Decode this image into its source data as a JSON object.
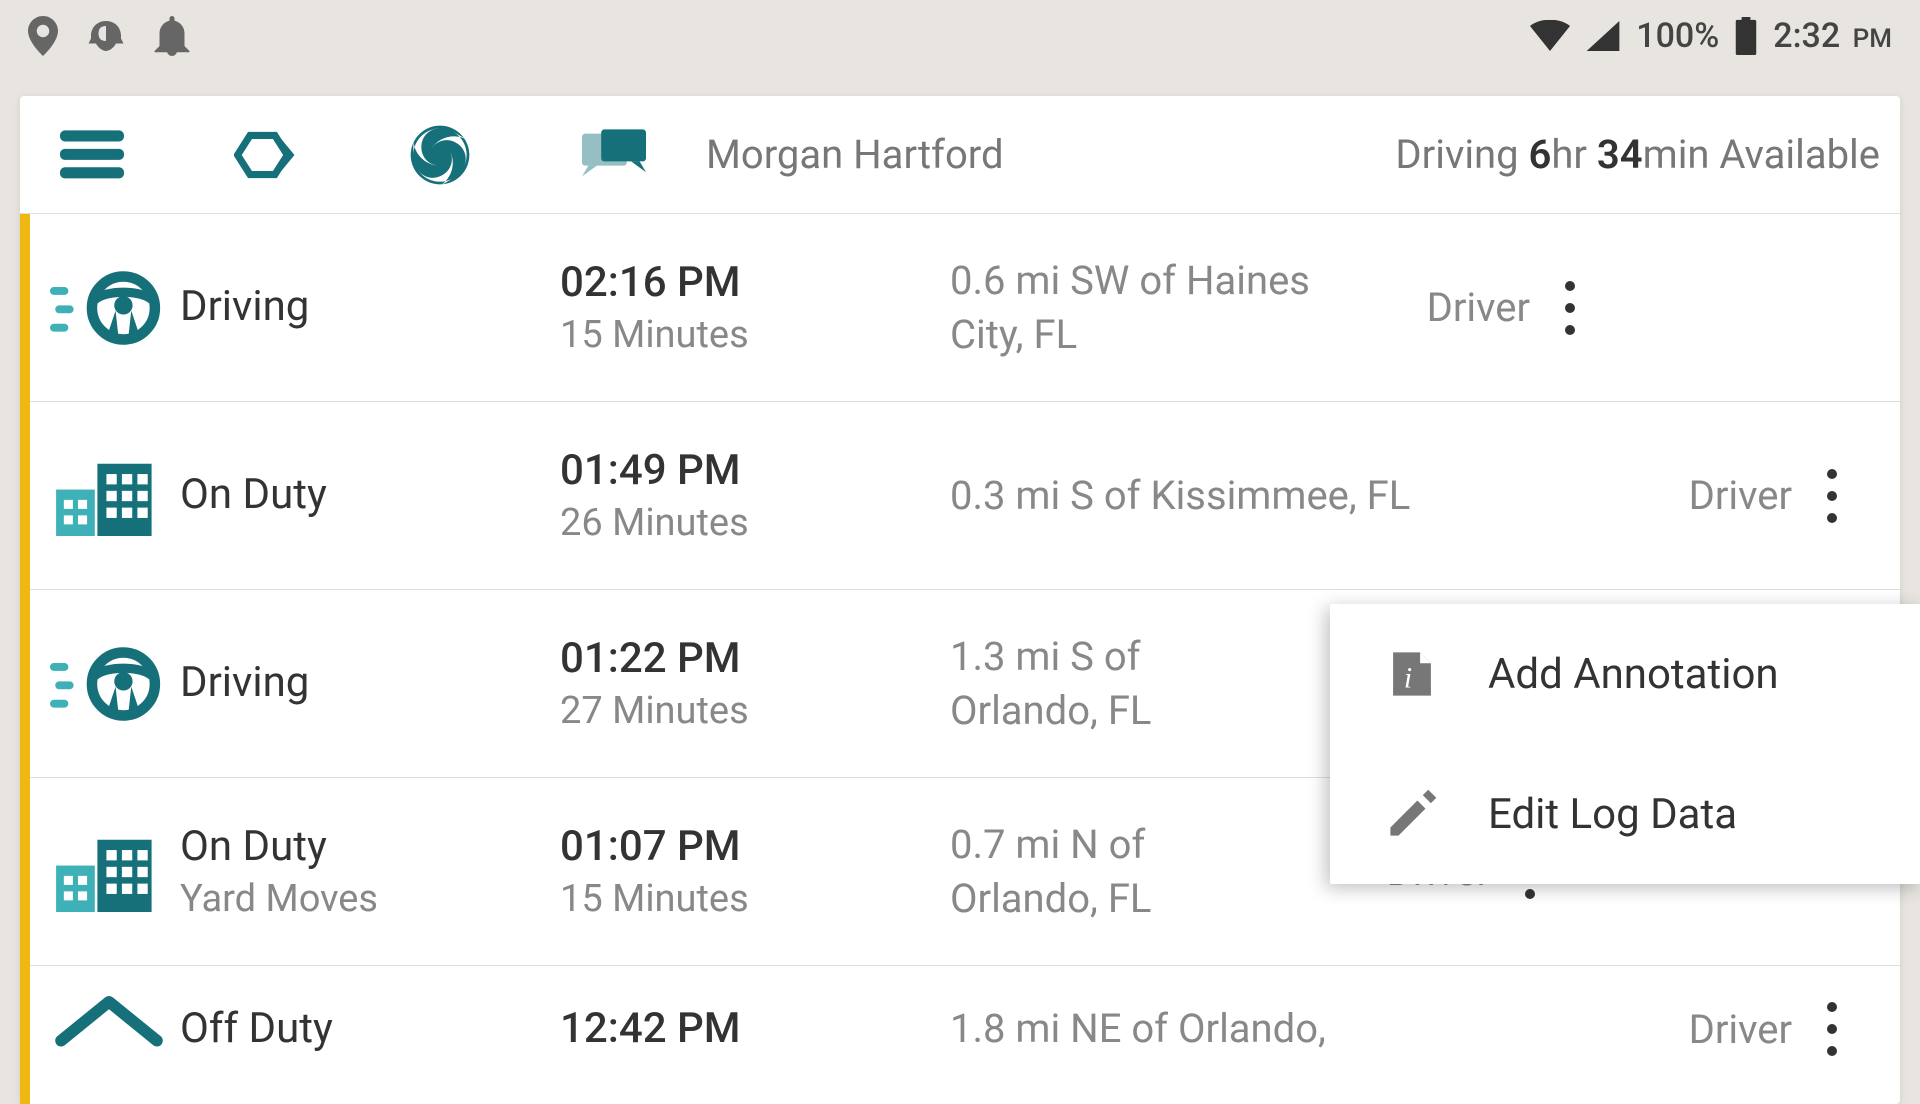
{
  "status_bar": {
    "battery_pct": "100%",
    "time": "2:32",
    "time_suffix": "PM"
  },
  "header": {
    "driver_name": "Morgan Hartford",
    "availability_prefix": "Driving ",
    "availability_hours": "6",
    "availability_hours_unit": "hr ",
    "availability_mins": "34",
    "availability_mins_unit": "min Available"
  },
  "logs": [
    {
      "status": "Driving",
      "sub": "",
      "time": "02:16 PM",
      "duration": "15 Minutes",
      "location": "0.6 mi SW of Haines City, FL",
      "role": "Driver",
      "icon": "driving"
    },
    {
      "status": "On Duty",
      "sub": "",
      "time": "01:49 PM",
      "duration": "26 Minutes",
      "location": "0.3 mi S of Kissimmee, FL",
      "role": "Driver",
      "icon": "onduty"
    },
    {
      "status": "Driving",
      "sub": "",
      "time": "01:22 PM",
      "duration": "27 Minutes",
      "location": "1.3 mi S of Orlando, FL",
      "role": "",
      "icon": "driving"
    },
    {
      "status": "On Duty",
      "sub": "Yard Moves",
      "time": "01:07 PM",
      "duration": "15 Minutes",
      "location": "0.7 mi N of Orlando, FL",
      "role": "Driver",
      "icon": "onduty"
    },
    {
      "status": "Off Duty",
      "sub": "",
      "time": "12:42 PM",
      "duration": "",
      "location": "1.8 mi NE of Orlando,",
      "role": "Driver",
      "icon": "offduty"
    }
  ],
  "popup": {
    "annotate_label": "Add Annotation",
    "edit_label": "Edit Log Data"
  }
}
